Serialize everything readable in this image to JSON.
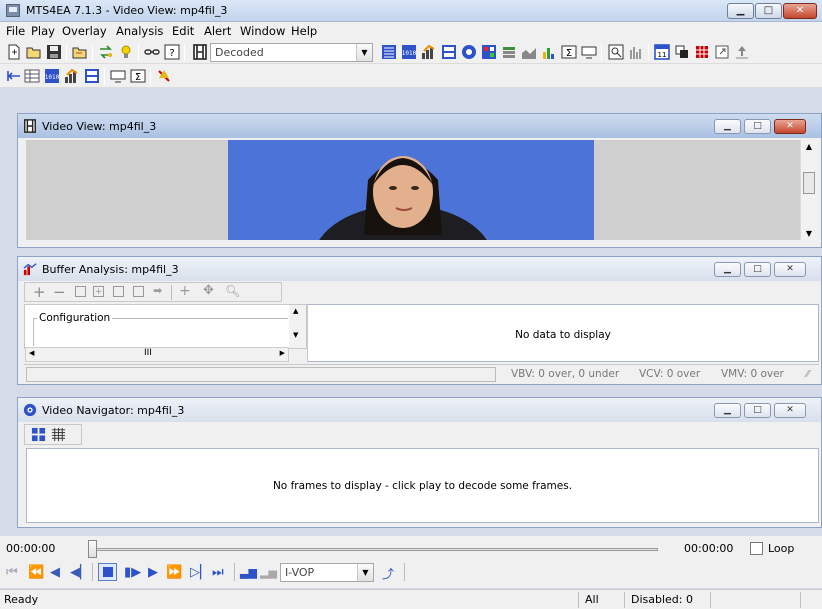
{
  "window": {
    "title": "MTS4EA 7.1.3 - Video View: mp4fil_3"
  },
  "menu": [
    "File",
    "Play",
    "Overlay",
    "Analysis",
    "Edit",
    "Alert",
    "Window",
    "Help"
  ],
  "toolbar": {
    "mode_select": "Decoded",
    "frame_type_select": "I-VOP"
  },
  "video_view": {
    "title": "Video View: mp4fil_3"
  },
  "buffer_analysis": {
    "title": "Buffer Analysis: mp4fil_3",
    "config_label": "Configuration",
    "hscroll_thumb": "III",
    "empty_message": "No data to display",
    "status": {
      "vbv": "VBV: 0 over, 0 under",
      "vcv": "VCV: 0 over",
      "vmv": "VMV: 0 over"
    }
  },
  "video_navigator": {
    "title": "Video Navigator: mp4fil_3",
    "empty_message": "No frames to display - click play to decode some frames."
  },
  "playback": {
    "time_start": "00:00:00",
    "time_end": "00:00:00",
    "loop_label": "Loop"
  },
  "statusbar": {
    "ready": "Ready",
    "all": "All",
    "disabled": "Disabled: 0"
  },
  "colors": {
    "video_blue": "#4b73d8",
    "title_active": "#a9c0e2",
    "close_red": "#c5462d"
  }
}
